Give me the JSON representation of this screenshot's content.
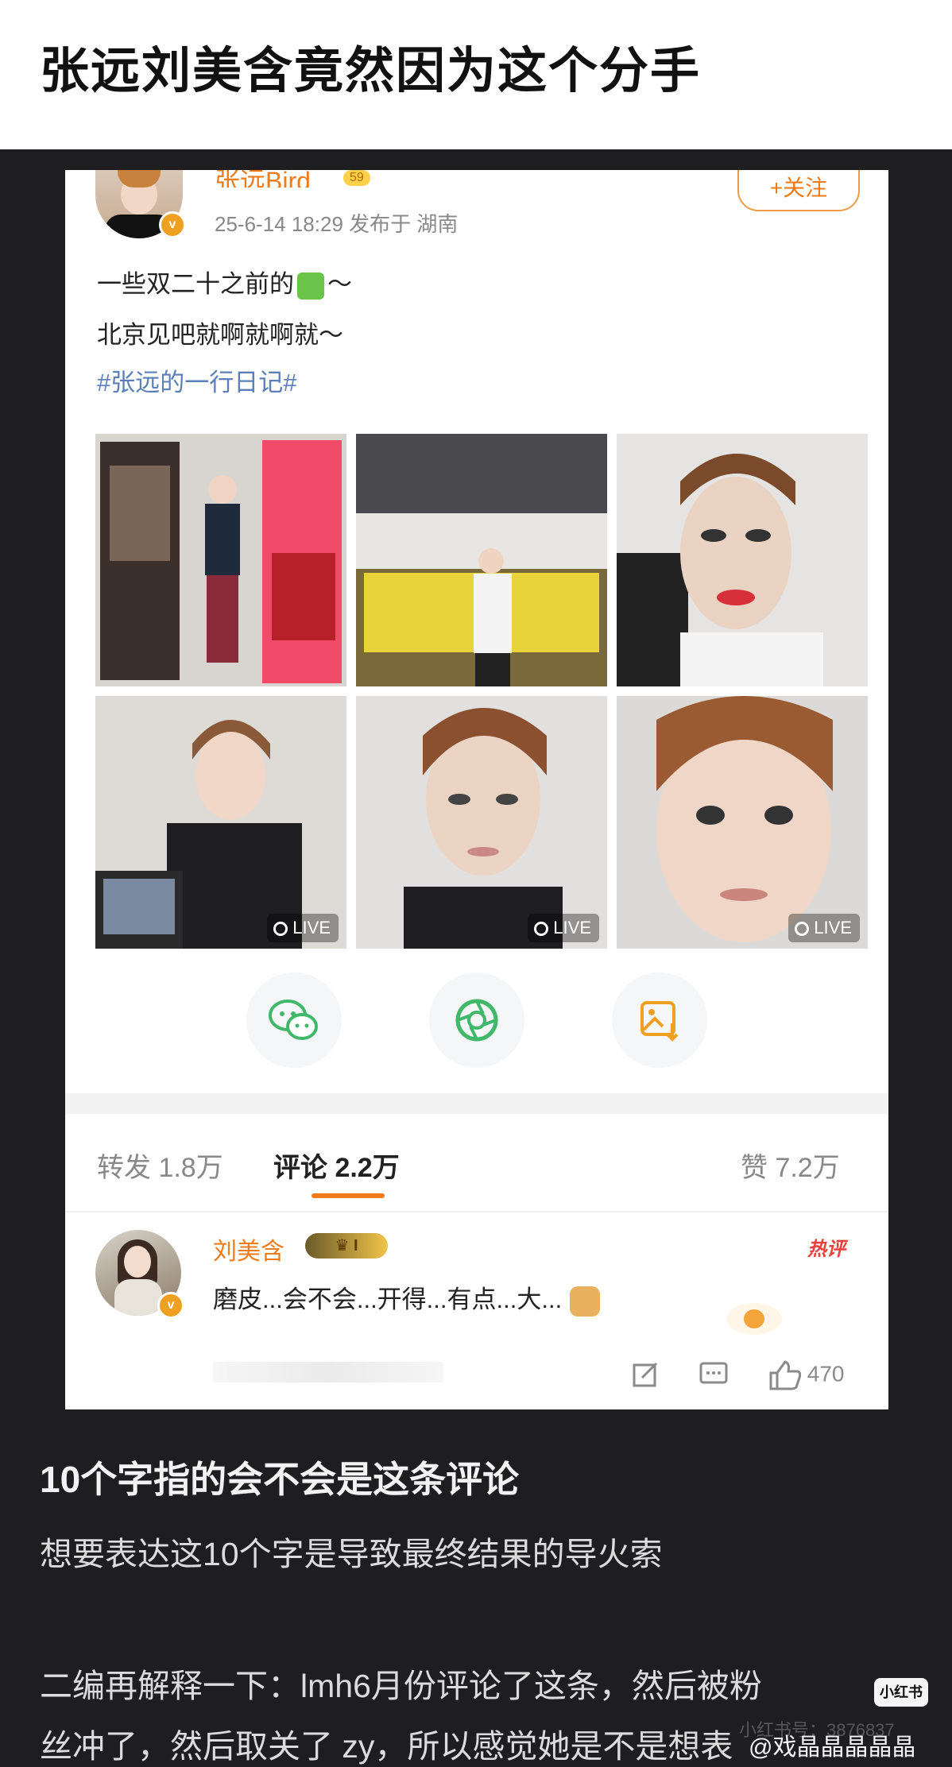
{
  "page": {
    "headline": "张远刘美含竟然因为这个分手"
  },
  "post": {
    "username": "张远Bird",
    "level": "59",
    "time_location": "25-6-14 18:29  发布于 湖南",
    "follow_label": "+关注",
    "line1_before": "一些双二十之前的",
    "line1_after": "～",
    "line2": "北京见吧就啊就啊就～",
    "hashtag": "#张远的一行日记#",
    "photo_badges": [
      "LIVE",
      "LIVE",
      "LIVE"
    ],
    "share_icons": [
      "wechat-icon",
      "moments-icon",
      "save-image-icon"
    ]
  },
  "tabs": {
    "repost": "转发 1.8万",
    "comment": "评论 2.2万",
    "like": "赞 7.2万"
  },
  "comment": {
    "name": "刘美含",
    "badge": "I",
    "hot": "热评",
    "text": "磨皮...会不会...开得...有点...大...",
    "like_count": "470"
  },
  "article": {
    "heading": "10个字指的会不会是这条评论",
    "para1": "想要表达这10个字是导致最终结果的导火索",
    "para2": "二编再解释一下：lmh6月份评论了这条，然后被粉",
    "para3": "丝冲了，然后取关了 zy，所以感觉她是不是想表",
    "xhs_badge": "小红书",
    "watermark": "@戏晶晶晶晶晶",
    "watermark_faint": "小红书号：3876837"
  },
  "colors": {
    "accent": "#f07b18",
    "background": "#1e1e21",
    "hashtag": "#5b7fb8"
  }
}
